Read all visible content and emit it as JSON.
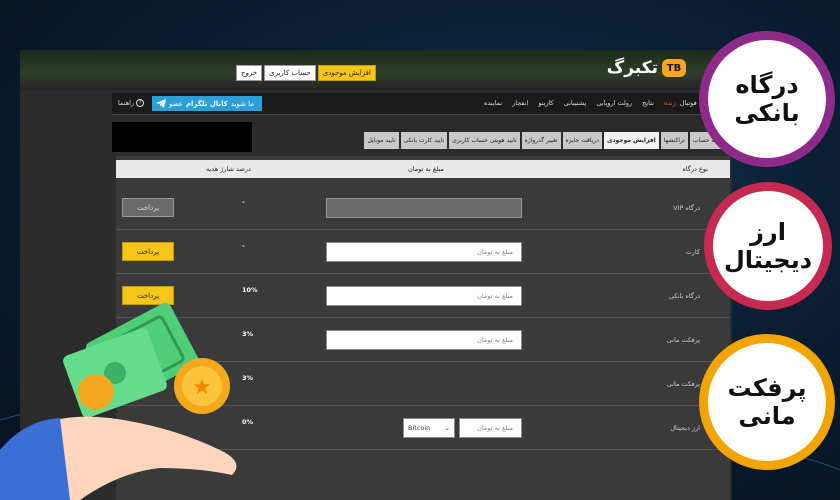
{
  "site": {
    "logo_badge": "TB",
    "logo_text": "تکبرگ",
    "top_buttons": [
      "افزایش موجودی",
      "حساب کاربری",
      "خروج"
    ],
    "nav": {
      "live_prefix": "زنده",
      "items": [
        "پیش‌بینی فوتبال",
        "نتایج",
        "رولت اروپایی",
        "پشتیبانی",
        "کازینو",
        "انفجار",
        "نماینده"
      ],
      "telegram_prefix": "عضو",
      "telegram_strong": "کانال تلگرام",
      "telegram_suffix": "ما شوید",
      "help": "راهنما"
    },
    "tabs": [
      "خلاصه حساب",
      "تراکنشها",
      "افزایش موجودی",
      "دریافت جایزه",
      "تغییر گذرواژه",
      "تایید هویتی حساب کاربری",
      "تایید کارت بانکی",
      "تایید موبایل"
    ],
    "table": {
      "headers": [
        "نوع درگاه",
        "مبلغ به تومان",
        "درصد شارژ هدیه"
      ],
      "rows": [
        {
          "label": "VIP درگاه",
          "placeholder": "",
          "pct": "-",
          "button": "پرداخت",
          "disabled": true
        },
        {
          "label": "کارت",
          "placeholder": "مبلغ به تومان",
          "pct": "-",
          "button": "پرداخت",
          "disabled": false
        },
        {
          "label": "درگاه بانکی",
          "placeholder": "مبلغ به تومان",
          "pct": "10%",
          "button": "پرداخت",
          "disabled": false
        },
        {
          "label": "پرفکت مانی",
          "placeholder": "مبلغ به تومان",
          "pct": "3%",
          "button": "",
          "disabled": false
        },
        {
          "label": "پرفکت مانی",
          "placeholder": "",
          "pct": "3%",
          "button": "",
          "disabled": false
        },
        {
          "label": "ارز دیجیتال",
          "placeholder": "مبلغ به تومان",
          "pct": "0%",
          "button": "",
          "select": "Bitcoin",
          "disabled": false
        }
      ]
    }
  },
  "badges": [
    "درگاه بانکی",
    "ارز دیجیتال",
    "پرفکت مانی"
  ],
  "colors": {
    "accent_yellow": "#f5c518",
    "telegram_blue": "#2a9fd8",
    "badge1": "#8e2b8a",
    "badge2": "#c62a52",
    "badge3": "#f2a400"
  }
}
